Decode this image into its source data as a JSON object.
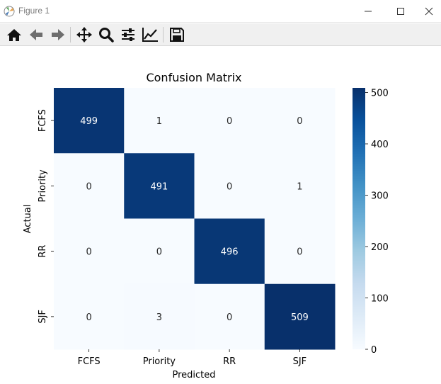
{
  "window": {
    "title": "Figure 1"
  },
  "toolbar": {
    "tools": [
      "home-icon",
      "back-arrow-icon",
      "forward-arrow-icon",
      "pan-icon",
      "zoom-icon",
      "configure-subplots-icon",
      "edit-axis-icon",
      "save-icon"
    ]
  },
  "chart_data": {
    "type": "heatmap",
    "title": "Confusion Matrix",
    "xlabel": "Predicted",
    "ylabel": "Actual",
    "x_categories": [
      "FCFS",
      "Priority",
      "RR",
      "SJF"
    ],
    "y_categories": [
      "FCFS",
      "Priority",
      "RR",
      "SJF"
    ],
    "values": [
      [
        499,
        1,
        0,
        0
      ],
      [
        0,
        491,
        0,
        1
      ],
      [
        0,
        0,
        496,
        0
      ],
      [
        0,
        3,
        0,
        509
      ]
    ],
    "colormap": "Blues",
    "vmin": 0,
    "vmax": 509,
    "colorbar_ticks": [
      "0",
      "100",
      "200",
      "300",
      "400",
      "500"
    ],
    "colorbar_tick_values": [
      0,
      100,
      200,
      300,
      400,
      500
    ]
  }
}
